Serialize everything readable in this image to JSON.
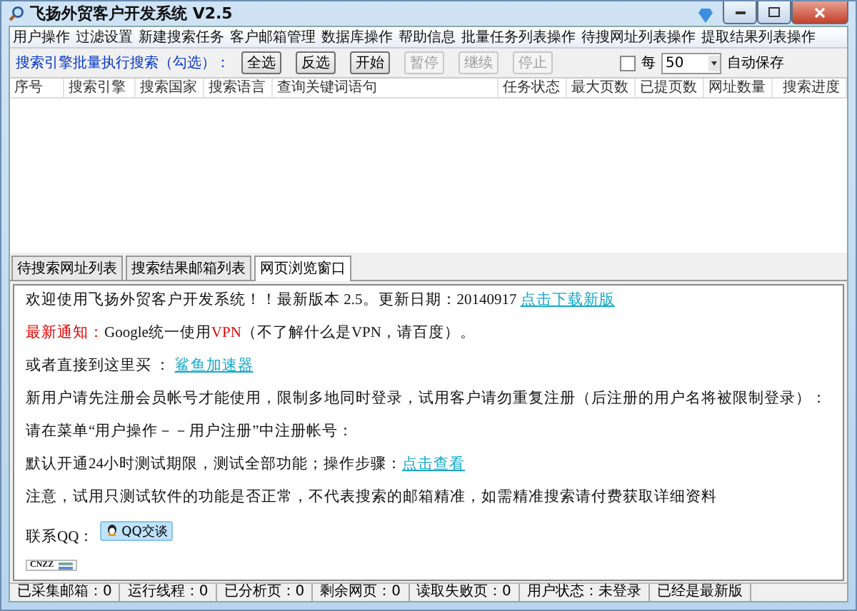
{
  "window": {
    "title": "飞扬外贸客户开发系统 V2.5"
  },
  "menu": [
    "用户操作",
    "过滤设置",
    "新建搜索任务",
    "客户邮箱管理",
    "数据库操作",
    "帮助信息",
    "批量任务列表操作",
    "待搜网址列表操作",
    "提取结果列表操作"
  ],
  "toolbar": {
    "label": "搜索引擎批量执行搜索（勾选）：",
    "buttons": [
      {
        "label": "全选",
        "disabled": false
      },
      {
        "label": "反选",
        "disabled": false
      },
      {
        "label": "开始",
        "disabled": false
      },
      {
        "label": "暂停",
        "disabled": true
      },
      {
        "label": "继续",
        "disabled": true
      },
      {
        "label": "停止",
        "disabled": true
      }
    ],
    "autosave": {
      "prefix": "每",
      "checked": false,
      "value": "50",
      "suffix": "自动保存"
    }
  },
  "table": {
    "columns": [
      "序号",
      "搜索引擎",
      "搜索国家",
      "搜索语言",
      "查询关键词语句",
      "任务状态",
      "最大页数",
      "已提页数",
      "网址数量",
      "搜索进度"
    ]
  },
  "tabs": [
    {
      "label": "待搜索网址列表",
      "selected": false
    },
    {
      "label": "搜索结果邮箱列表",
      "selected": false
    },
    {
      "label": "网页浏览窗口",
      "selected": true
    }
  ],
  "content": {
    "paragraphs": [
      [
        {
          "kind": "plain",
          "text": "欢迎使用飞扬外贸客户开发系统！！最新版本 2.5。更新日期：20140917 "
        },
        {
          "kind": "link",
          "text": "点击下载新版"
        }
      ],
      [
        {
          "kind": "alert",
          "text": "最新通知："
        },
        {
          "kind": "plain",
          "text": "Google统一使用"
        },
        {
          "kind": "alert",
          "text": "VPN"
        },
        {
          "kind": "plain",
          "text": "（不了解什么是VPN，请百度）。"
        }
      ],
      [
        {
          "kind": "plain",
          "text": "或者直接到这里买 ： "
        },
        {
          "kind": "link",
          "text": "鲨鱼加速器"
        }
      ],
      [
        {
          "kind": "plain",
          "text": "新用户请先注册会员帐号才能使用，限制多地同时登录，试用客户请勿重复注册（后注册的用户名将被限制登录）："
        }
      ],
      [
        {
          "kind": "plain",
          "text": "请在菜单“用户操作－－用户注册”中注册帐号："
        }
      ],
      [
        {
          "kind": "plain",
          "text": "默认开通24小时测试期限，测试全部功能；操作步骤："
        },
        {
          "kind": "link",
          "text": "点击查看"
        }
      ],
      [
        {
          "kind": "plain",
          "text": "注意，试用只测试软件的功能是否正常，不代表搜索的邮箱精准，如需精准搜索请付费获取详细资料"
        }
      ]
    ],
    "contact": {
      "label": "联系QQ：",
      "button": "QQ交谈"
    },
    "badge": "CNZZ"
  },
  "status_bar": [
    "已采集邮箱：0",
    "运行线程：0",
    "已分析页：0",
    "剩余网页：0",
    "读取失败页：0",
    "用户状态：未登录",
    "已经是最新版"
  ]
}
